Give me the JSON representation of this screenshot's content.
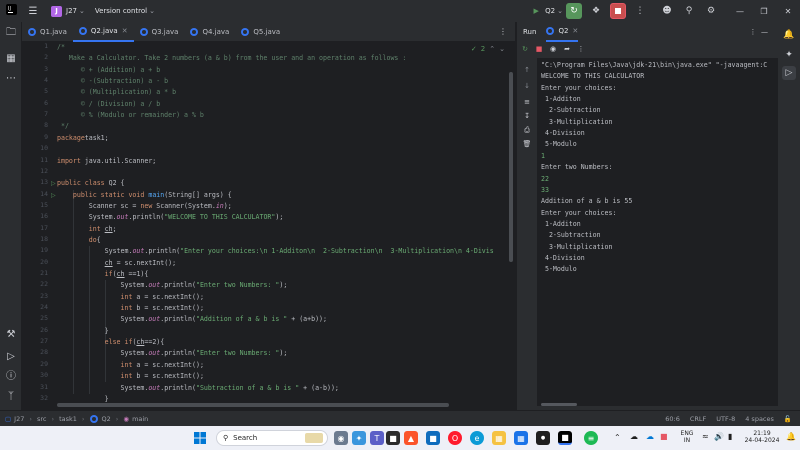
{
  "titlebar": {
    "project_badge": "J",
    "project_name": "J27",
    "vcs_label": "Version control",
    "run_config": "Q2"
  },
  "tabs": [
    {
      "label": "Q1.java",
      "active": false
    },
    {
      "label": "Q2.java",
      "active": true
    },
    {
      "label": "Q3.java",
      "active": false
    },
    {
      "label": "Q4.java",
      "active": false
    },
    {
      "label": "Q5.java",
      "active": false
    }
  ],
  "editor": {
    "inspection_count": "2",
    "line_numbers": [
      "1",
      "2",
      "3",
      "4",
      "5",
      "6",
      "7",
      "8",
      "9",
      "10",
      "11",
      "12",
      "13",
      "14",
      "15",
      "16",
      "17",
      "18",
      "19",
      "20",
      "21",
      "22",
      "23",
      "24",
      "25",
      "26",
      "27",
      "28",
      "29",
      "30",
      "31",
      "32"
    ],
    "run_markers": [
      13,
      14
    ],
    "lines": [
      [
        [
          "cm",
          "/*"
        ]
      ],
      [
        [
          "cm",
          "   Make a Calculator. Take 2 numbers (a & b) from the user and an operation as follows :"
        ]
      ],
      [
        [
          "cm",
          "      © + (Addition) a + b"
        ]
      ],
      [
        [
          "cm",
          "      © -(Subtraction) a - b"
        ]
      ],
      [
        [
          "cm",
          "      © (Multiplication) a * b"
        ]
      ],
      [
        [
          "cm",
          "      © / (Division) a / b"
        ]
      ],
      [
        [
          "cm",
          "      © % (Modulo or remainder) a % b"
        ]
      ],
      [
        [
          "cm",
          " */"
        ]
      ],
      [
        [
          "kw",
          "package"
        ],
        [
          "",
          "task1;"
        ]
      ],
      [
        [
          "",
          ""
        ]
      ],
      [
        [
          "kw",
          "import"
        ],
        [
          "",
          " java.util.Scanner;"
        ]
      ],
      [
        [
          "",
          ""
        ]
      ],
      [
        [
          "kw",
          "public class"
        ],
        [
          "",
          " Q2 {"
        ]
      ],
      [
        [
          "",
          "    "
        ],
        [
          "kw",
          "public static void"
        ],
        [
          "",
          " "
        ],
        [
          "fn",
          "main"
        ],
        [
          "",
          "(String[] args) {"
        ]
      ],
      [
        [
          "",
          "        Scanner sc = "
        ],
        [
          "kw",
          "new"
        ],
        [
          "",
          " Scanner(System."
        ],
        [
          "fld",
          "in"
        ],
        [
          "",
          ");"
        ]
      ],
      [
        [
          "",
          "        System."
        ],
        [
          "fld",
          "out"
        ],
        [
          "",
          ".println("
        ],
        [
          "st",
          "\"WELCOME TO THIS CALCULATOR\""
        ],
        [
          "",
          ");"
        ]
      ],
      [
        [
          "",
          "        "
        ],
        [
          "kw",
          "int"
        ],
        [
          "",
          " "
        ],
        [
          "und",
          "ch"
        ],
        [
          "",
          ";"
        ]
      ],
      [
        [
          "",
          "        "
        ],
        [
          "kw",
          "do"
        ],
        [
          "",
          "{"
        ]
      ],
      [
        [
          "",
          "            System."
        ],
        [
          "fld",
          "out"
        ],
        [
          "",
          ".println("
        ],
        [
          "st",
          "\"Enter your choices:\\n 1-Additon\\n  2-Subtraction\\n  3-Multiplication\\n 4-Divis"
        ]
      ],
      [
        [
          "",
          "            "
        ],
        [
          "und",
          "ch"
        ],
        [
          "",
          " = sc.nextInt();"
        ]
      ],
      [
        [
          "",
          "            "
        ],
        [
          "kw",
          "if"
        ],
        [
          "",
          "("
        ],
        [
          "und",
          "ch"
        ],
        [
          "",
          " ==1){"
        ]
      ],
      [
        [
          "",
          "                System."
        ],
        [
          "fld",
          "out"
        ],
        [
          "",
          ".println("
        ],
        [
          "st",
          "\"Enter two Numbers: \""
        ],
        [
          "",
          ");"
        ]
      ],
      [
        [
          "",
          "                "
        ],
        [
          "kw",
          "int"
        ],
        [
          "",
          " a = sc.nextInt();"
        ]
      ],
      [
        [
          "",
          "                "
        ],
        [
          "kw",
          "int"
        ],
        [
          "",
          " b = sc.nextInt();"
        ]
      ],
      [
        [
          "",
          "                System."
        ],
        [
          "fld",
          "out"
        ],
        [
          "",
          ".println("
        ],
        [
          "st",
          "\"Addition of a & b is \""
        ],
        [
          "",
          " + (a+b));"
        ]
      ],
      [
        [
          "",
          "            }"
        ]
      ],
      [
        [
          "",
          "            "
        ],
        [
          "kw",
          "else if"
        ],
        [
          "",
          "("
        ],
        [
          "und",
          "ch"
        ],
        [
          "",
          "==2){"
        ]
      ],
      [
        [
          "",
          "                System."
        ],
        [
          "fld",
          "out"
        ],
        [
          "",
          ".println("
        ],
        [
          "st",
          "\"Enter two Numbers: \""
        ],
        [
          "",
          ");"
        ]
      ],
      [
        [
          "",
          "                "
        ],
        [
          "kw",
          "int"
        ],
        [
          "",
          " a = sc.nextInt();"
        ]
      ],
      [
        [
          "",
          "                "
        ],
        [
          "kw",
          "int"
        ],
        [
          "",
          " b = sc.nextInt();"
        ]
      ],
      [
        [
          "",
          "                System."
        ],
        [
          "fld",
          "out"
        ],
        [
          "",
          ".println("
        ],
        [
          "st",
          "\"Subtraction of a & b is \""
        ],
        [
          "",
          " + (a-b));"
        ]
      ],
      [
        [
          "",
          "            }"
        ]
      ]
    ]
  },
  "run_panel": {
    "title": "Run",
    "tab_label": "Q2",
    "console": [
      {
        "text": "\"C:\\Program Files\\Java\\jdk-21\\bin\\java.exe\" \"-javaagent:C",
        "input": false
      },
      {
        "text": "WELCOME TO THIS CALCULATOR",
        "input": false
      },
      {
        "text": "Enter your choices:",
        "input": false
      },
      {
        "text": " 1-Additon",
        "input": false
      },
      {
        "text": "  2-Subtraction",
        "input": false
      },
      {
        "text": "  3-Multiplication",
        "input": false
      },
      {
        "text": " 4-Division",
        "input": false
      },
      {
        "text": " 5-Modulo",
        "input": false
      },
      {
        "text": "1",
        "input": true
      },
      {
        "text": "Enter two Numbers:",
        "input": false
      },
      {
        "text": "22",
        "input": true
      },
      {
        "text": "33",
        "input": true
      },
      {
        "text": "Addition of a & b is 55",
        "input": false
      },
      {
        "text": "Enter your choices:",
        "input": false
      },
      {
        "text": " 1-Additon",
        "input": false
      },
      {
        "text": "  2-Subtraction",
        "input": false
      },
      {
        "text": "  3-Multiplication",
        "input": false
      },
      {
        "text": " 4-Division",
        "input": false
      },
      {
        "text": " 5-Modulo",
        "input": false
      }
    ]
  },
  "statusbar": {
    "crumbs": [
      "J27",
      "src",
      "task1",
      "Q2",
      "main"
    ],
    "position": "60:6",
    "line_ending": "CRLF",
    "encoding": "UTF-8",
    "indent": "4 spaces"
  },
  "taskbar": {
    "search_placeholder": "Search",
    "lang_line1": "ENG",
    "lang_line2": "IN",
    "time": "21:19",
    "date": "24-04-2024"
  },
  "colors": {
    "accent": "#3574f0",
    "run_green": "#57965c",
    "stop_red": "#c94f4f",
    "keyword": "#cf8e6d",
    "string": "#6aab73",
    "comment": "#5f826b",
    "field": "#c77dbb",
    "method": "#56a8f5"
  }
}
